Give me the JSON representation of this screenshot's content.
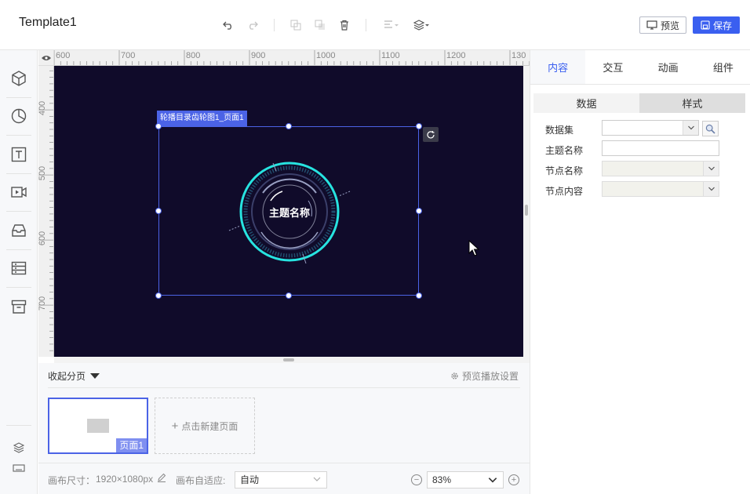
{
  "app": {
    "title": "Template1"
  },
  "toolbar": {
    "icons": [
      "undo-icon",
      "redo-icon",
      "copy-icon",
      "paste-icon",
      "delete-icon",
      "align-icon",
      "layer-order-icon"
    ],
    "preview_label": "预览",
    "save_label": "保存"
  },
  "sidebar": {
    "tools": [
      "3d-cube-icon",
      "pie-chart-icon",
      "text-icon",
      "video-icon",
      "inbox-icon",
      "list-icon",
      "archive-icon"
    ],
    "bottom": [
      "layers-icon",
      "keyboard-icon"
    ]
  },
  "ruler": {
    "top_labels": [
      "600",
      "700",
      "800",
      "900",
      "1000",
      "1100",
      "1200",
      "130"
    ],
    "left_labels": [
      "400",
      "500",
      "600",
      "700"
    ]
  },
  "canvas": {
    "background": "#100b2a",
    "selected_component_label": "轮播目录齿轮图1_页面1",
    "ring_title": "主题名称",
    "ring_color": "#27e3e0",
    "selection_color": "#4b63e6"
  },
  "pages": {
    "collapse_label": "收起分页",
    "settings_label": "预览播放设置",
    "items": [
      {
        "label": "页面1"
      }
    ],
    "new_page_label": "点击新建页面"
  },
  "statusbar": {
    "canvas_size_label": "画布尺寸：",
    "canvas_size_value": "1920×1080px",
    "fit_label": "画布自适应:",
    "fit_value": "自动",
    "zoom_value": "83%",
    "zoom_out": "−",
    "zoom_in": "+"
  },
  "right_panel": {
    "tabs": [
      "内容",
      "交互",
      "动画",
      "组件"
    ],
    "active_tab": "内容",
    "subtabs": [
      "数据",
      "样式"
    ],
    "fields": [
      {
        "label": "数据集",
        "value": ""
      },
      {
        "label": "主题名称",
        "value": ""
      },
      {
        "label": "节点名称",
        "value": ""
      },
      {
        "label": "节点内容",
        "value": ""
      }
    ]
  },
  "colors": {
    "accent": "#3a5ff0",
    "canvas_bg": "#100b2a"
  }
}
